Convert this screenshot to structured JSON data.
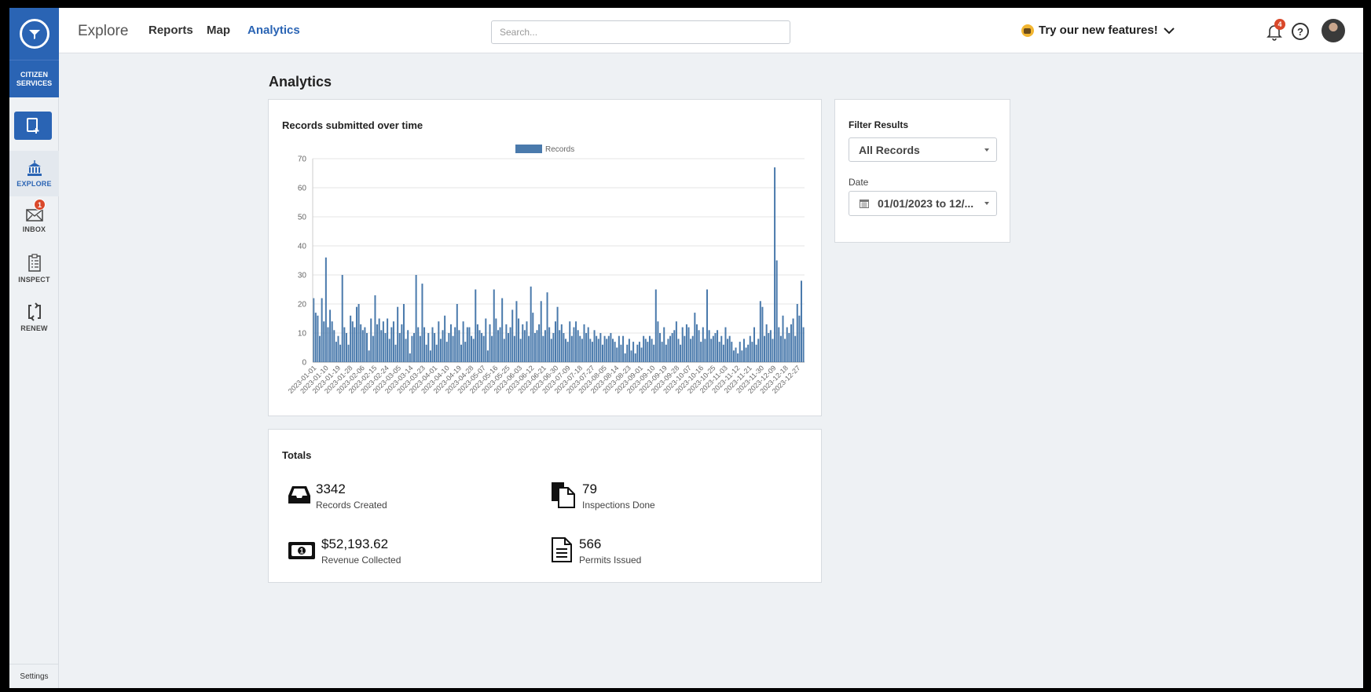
{
  "sidebar": {
    "brand": "CITIZEN SERVICES",
    "items": [
      {
        "label": "EXPLORE"
      },
      {
        "label": "INBOX",
        "badge": "1"
      },
      {
        "label": "INSPECT"
      },
      {
        "label": "RENEW"
      }
    ],
    "settings": "Settings"
  },
  "topbar": {
    "explore": "Explore",
    "reports": "Reports",
    "map": "Map",
    "analytics": "Analytics",
    "search_placeholder": "Search...",
    "try_features": "Try our new features!",
    "notifications_count": "4",
    "help": "?"
  },
  "page": {
    "title": "Analytics"
  },
  "chart_card": {
    "title": "Records submitted over time"
  },
  "chart_data": {
    "type": "bar",
    "legend": [
      "Records"
    ],
    "legend_placement": "top-center",
    "color": "#4a7aac",
    "ylim": [
      0,
      70
    ],
    "yticks": [
      0,
      10,
      20,
      30,
      40,
      50,
      60,
      70
    ],
    "grid": true,
    "xlabel": "",
    "ylabel": "",
    "x_tick_labels": [
      "2023-01-01",
      "2023-01-10",
      "2023-01-19",
      "2023-01-28",
      "2023-02-06",
      "2023-02-15",
      "2023-02-24",
      "2023-03-05",
      "2023-03-14",
      "2023-03-23",
      "2023-04-01",
      "2023-04-10",
      "2023-04-19",
      "2023-04-28",
      "2023-05-07",
      "2023-05-16",
      "2023-05-25",
      "2023-06-03",
      "2023-06-12",
      "2023-06-21",
      "2023-06-30",
      "2023-07-09",
      "2023-07-18",
      "2023-07-27",
      "2023-08-05",
      "2023-08-14",
      "2023-08-23",
      "2023-09-01",
      "2023-09-10",
      "2023-09-19",
      "2023-09-28",
      "2023-10-07",
      "2023-10-16",
      "2023-10-25",
      "2023-11-03",
      "2023-11-12",
      "2023-11-21",
      "2023-11-30",
      "2023-12-09",
      "2023-12-18",
      "2023-12-27"
    ],
    "series": [
      {
        "name": "Records",
        "start": "2023-01-01",
        "values": [
          22,
          17,
          16,
          9,
          22,
          14,
          36,
          12,
          18,
          14,
          11,
          7,
          9,
          6,
          30,
          12,
          10,
          6,
          16,
          14,
          12,
          19,
          20,
          13,
          11,
          12,
          10,
          4,
          15,
          9,
          23,
          13,
          15,
          11,
          14,
          10,
          15,
          8,
          12,
          14,
          6,
          19,
          10,
          13,
          20,
          8,
          11,
          3,
          9,
          10,
          30,
          12,
          9,
          27,
          12,
          6,
          10,
          4,
          12,
          10,
          6,
          14,
          8,
          11,
          16,
          7,
          10,
          13,
          9,
          12,
          20,
          11,
          6,
          14,
          7,
          12,
          12,
          9,
          8,
          25,
          13,
          11,
          10,
          9,
          15,
          4,
          13,
          9,
          25,
          15,
          11,
          12,
          22,
          8,
          13,
          10,
          12,
          18,
          9,
          21,
          15,
          8,
          13,
          11,
          14,
          9,
          26,
          17,
          10,
          11,
          13,
          21,
          9,
          11,
          24,
          12,
          8,
          10,
          14,
          19,
          11,
          13,
          10,
          8,
          7,
          14,
          9,
          12,
          14,
          11,
          9,
          8,
          13,
          10,
          12,
          8,
          7,
          11,
          9,
          8,
          10,
          6,
          9,
          8,
          9,
          10,
          8,
          7,
          5,
          9,
          6,
          9,
          3,
          6,
          8,
          4,
          7,
          3,
          6,
          7,
          5,
          9,
          8,
          7,
          9,
          8,
          6,
          25,
          14,
          10,
          7,
          12,
          6,
          8,
          9,
          10,
          11,
          14,
          8,
          6,
          12,
          9,
          13,
          12,
          8,
          9,
          17,
          13,
          11,
          7,
          12,
          8,
          25,
          11,
          8,
          9,
          10,
          11,
          7,
          9,
          6,
          12,
          8,
          9,
          7,
          4,
          5,
          3,
          7,
          4,
          8,
          5,
          6,
          9,
          7,
          12,
          6,
          8,
          21,
          19,
          9,
          13,
          10,
          11,
          8,
          67,
          35,
          12,
          9,
          16,
          8,
          12,
          10,
          13,
          15,
          9,
          20,
          16,
          28,
          12
        ]
      }
    ]
  },
  "filter": {
    "title": "Filter Results",
    "records_value": "All Records",
    "date_label": "Date",
    "date_value": "01/01/2023 to 12/..."
  },
  "totals": {
    "title": "Totals",
    "records_created": {
      "value": "3342",
      "label": "Records Created"
    },
    "inspections_done": {
      "value": "79",
      "label": "Inspections Done"
    },
    "revenue_collected": {
      "value": "$52,193.62",
      "label": "Revenue Collected"
    },
    "permits_issued": {
      "value": "566",
      "label": "Permits Issued"
    }
  }
}
